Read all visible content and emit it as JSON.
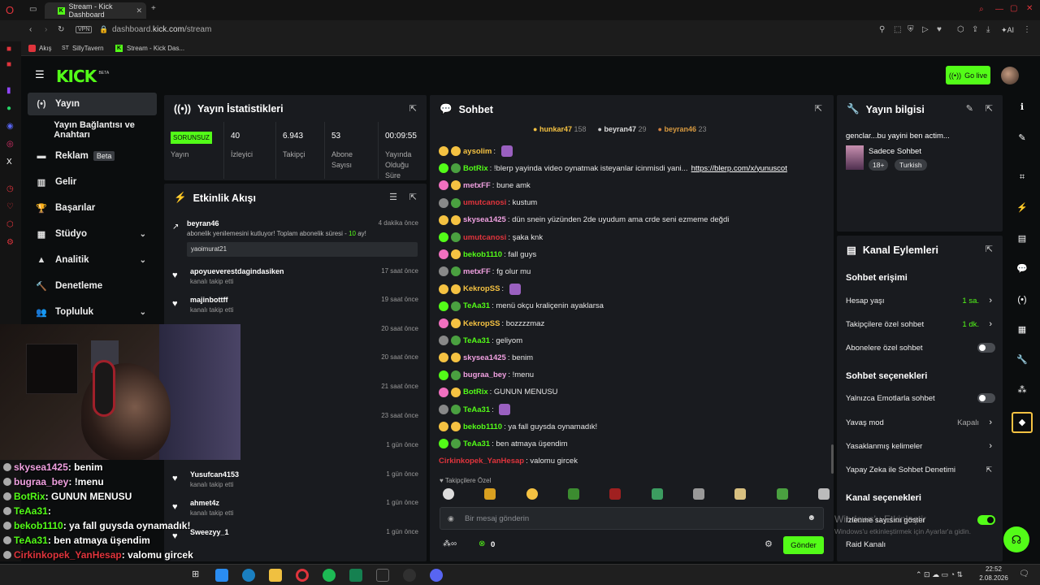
{
  "browser": {
    "tab_title": "Stream - Kick Dashboard",
    "vpn": "VPN",
    "url_host": "dashboard.",
    "url_domain": "kick.com",
    "url_path": "/stream",
    "ai_label": "AI",
    "bookmarks": [
      "Akış",
      "SillyTavern",
      "Stream - Kick Das..."
    ]
  },
  "header": {
    "logo": "KICK",
    "beta": "BETA",
    "go_live": "Go live"
  },
  "nav": [
    {
      "label": "Yayın",
      "icon": "stream-icon"
    },
    {
      "label": "Yayın Bağlantısı ve Anahtarı",
      "icon": ""
    },
    {
      "label": "Reklam",
      "icon": "ads-icon",
      "badge": "Beta"
    },
    {
      "label": "Gelir",
      "icon": "revenue-icon"
    },
    {
      "label": "Başarılar",
      "icon": "trophy-icon"
    },
    {
      "label": "Stüdyo",
      "icon": "studio-icon"
    },
    {
      "label": "Analitik",
      "icon": "analytics-icon"
    },
    {
      "label": "Denetleme",
      "icon": "moderation-icon"
    },
    {
      "label": "Topluluk",
      "icon": "community-icon"
    }
  ],
  "stats": {
    "title": "Yayın İstatistikleri",
    "status": "SORUNSUZ",
    "status_label": "Yayın",
    "items": [
      {
        "value": "40",
        "label": "İzleyici"
      },
      {
        "value": "6.943",
        "label": "Takipçi"
      },
      {
        "value": "53",
        "label": "Abone Sayısı"
      },
      {
        "value": "00:09:55",
        "label": "Yayında Olduğu Süre"
      }
    ]
  },
  "activity": {
    "title": "Etkinlik Akışı",
    "first": {
      "name": "beyran46",
      "time": "4 dakika önce",
      "text_pre": "abonelik yenilemesini kutluyor! Toplam abonelik süresi - ",
      "months": "10",
      "text_post": " ay!",
      "note": "yaoimurat21"
    },
    "items": [
      {
        "name": "apoyueverestdagindasiken",
        "sub": "kanalı takip etti",
        "time": "17 saat önce"
      },
      {
        "name": "majinbottff",
        "sub": "kanalı takip etti",
        "time": "19 saat önce"
      },
      {
        "name": "",
        "sub": "",
        "time": "20 saat önce"
      },
      {
        "name": "u",
        "sub": "",
        "time": "20 saat önce"
      },
      {
        "name": "",
        "sub": "",
        "time": "21 saat önce"
      },
      {
        "name": "",
        "sub": "",
        "time": "23 saat önce"
      },
      {
        "name": "",
        "sub": "",
        "time": "1 gün önce"
      },
      {
        "name": "Yusufcan4153",
        "sub": "kanalı takip etti",
        "time": "1 gün önce"
      },
      {
        "name": "ahmet4z",
        "sub": "kanalı takip etti",
        "time": "1 gün önce"
      },
      {
        "name": "Sweezyy_1",
        "sub": "",
        "time": "1 gün önce"
      }
    ]
  },
  "chat": {
    "title": "Sohbet",
    "leaders": [
      {
        "name": "hunkar47",
        "count": "158"
      },
      {
        "name": "beyran47",
        "count": "29"
      },
      {
        "name": "beyran46",
        "count": "23"
      }
    ],
    "messages": [
      {
        "user": "aysolim",
        "color": "#f5c242",
        "text": ""
      },
      {
        "user": "BotRix",
        "color": "#53fc18",
        "text": "!blerp yayinda video oynatmak isteyanlar icinmisdi yani...",
        "link": "https://blerp.com/x/yunuscot"
      },
      {
        "user": "metxFF",
        "color": "#f0a0e0",
        "text": "bune amk"
      },
      {
        "user": "umutcanosi",
        "color": "#e0343c",
        "text": "kustum"
      },
      {
        "user": "skysea1425",
        "color": "#f0a0e0",
        "text": "dün snein yüzünden 2de uyudum ama crde seni ezmeme değdi"
      },
      {
        "user": "umutcanosi",
        "color": "#e0343c",
        "text": "şaka knk"
      },
      {
        "user": "bekob1110",
        "color": "#53fc18",
        "text": "fall guys"
      },
      {
        "user": "metxFF",
        "color": "#f0a0e0",
        "text": "fg olur mu"
      },
      {
        "user": "KekropSS",
        "color": "#f5c242",
        "text": ""
      },
      {
        "user": "TeAa31",
        "color": "#53fc18",
        "text": "menü okçu kraliçenin ayaklarsa"
      },
      {
        "user": "KekropSS",
        "color": "#f5c242",
        "text": "bozzzzmaz"
      },
      {
        "user": "TeAa31",
        "color": "#53fc18",
        "text": "geliyom"
      },
      {
        "user": "skysea1425",
        "color": "#f0a0e0",
        "text": "benim"
      },
      {
        "user": "bugraa_bey",
        "color": "#f0a0e0",
        "text": "!menu"
      },
      {
        "user": "BotRix",
        "color": "#53fc18",
        "text": "GUNUN MENUSU"
      },
      {
        "user": "TeAa31",
        "color": "#53fc18",
        "text": ""
      },
      {
        "user": "bekob1110",
        "color": "#53fc18",
        "text": "ya fall guysda oynamadık!"
      },
      {
        "user": "TeAa31",
        "color": "#53fc18",
        "text": "ben atmaya üşendim"
      },
      {
        "user": "Cirkinkopek_YanHesap",
        "color": "#e0343c",
        "text": "valomu gircek"
      }
    ],
    "followers_only": "Takipçilere Özel",
    "placeholder": "Bir mesaj gönderin",
    "points": "0",
    "send": "Gönder"
  },
  "overlay": [
    {
      "user": "skysea1425",
      "color": "#f0a0e0",
      "text": " : benim"
    },
    {
      "user": "bugraa_bey",
      "color": "#f0a0e0",
      "text": " : !menu"
    },
    {
      "user": "BotRix",
      "color": "#53fc18",
      "text": " : GUNUN MENUSU"
    },
    {
      "user": "TeAa31",
      "color": "#53fc18",
      "text": " : "
    },
    {
      "user": "bekob1110",
      "color": "#53fc18",
      "text": " : ya fall guysda oynamadık!"
    },
    {
      "user": "TeAa31",
      "color": "#53fc18",
      "text": " : ben atmaya üşendim"
    },
    {
      "user": "Cirkinkopek_YanHesap",
      "color": "#e0343c",
      "text": " : valomu gircek"
    }
  ],
  "info": {
    "title": "Yayın bilgisi",
    "stream_title": "genclar...bu yayini ben actim...",
    "category": "Sadece Sohbet",
    "tags": [
      "18+",
      "Turkish"
    ]
  },
  "actions": {
    "title": "Kanal Eylemleri",
    "chat_access": "Sohbet erişimi",
    "rows_access": [
      {
        "label": "Hesap yaşı",
        "value": "1 sa."
      },
      {
        "label": "Takipçilere özel sohbet",
        "value": "1 dk."
      },
      {
        "label": "Abonelere özel sohbet",
        "value": ""
      }
    ],
    "chat_options": "Sohbet seçenekleri",
    "rows_options": [
      {
        "label": "Yalnızca Emotlarla sohbet",
        "value": ""
      },
      {
        "label": "Yavaş mod",
        "value": "Kapalı"
      },
      {
        "label": "Yasaklanmış kelimeler",
        "value": ""
      },
      {
        "label": "Yapay Zeka ile Sohbet Denetimi",
        "value": ""
      }
    ],
    "channel_options": "Kanal seçenekleri",
    "rows_channel": [
      {
        "label": "İzlenme sayısını göster",
        "value": ""
      },
      {
        "label": "Raid Kanalı",
        "value": ""
      }
    ]
  },
  "windows_watermark": {
    "line1": "Windows'u Etkinleştir",
    "line2": "Windows'u etkinleştirmek için Ayarlar'a gidin."
  },
  "clock": {
    "time": "22:52",
    "date": "2.08.2026"
  }
}
